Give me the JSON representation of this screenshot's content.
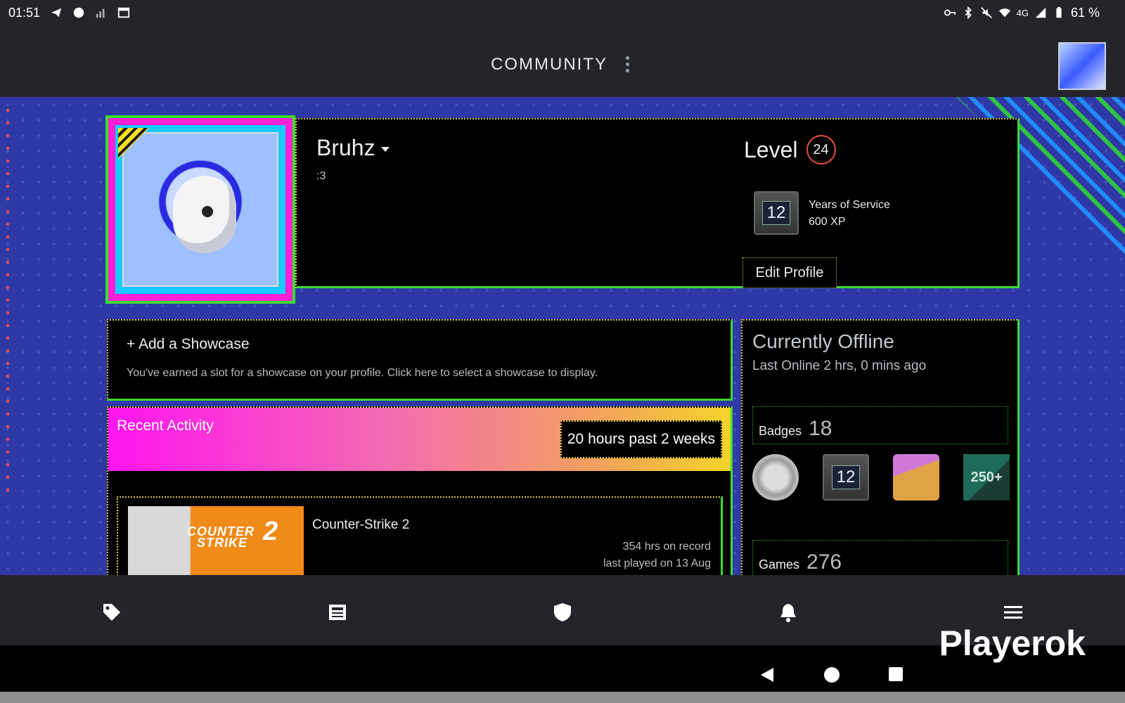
{
  "status_bar": {
    "time": "01:51",
    "battery": "61 %",
    "network": "4G"
  },
  "header": {
    "title": "COMMUNITY"
  },
  "profile": {
    "username": "Bruhz",
    "summary": ":3",
    "level_label": "Level",
    "level": "24",
    "favorite_badge": {
      "icon_text": "12",
      "name": "Years of Service",
      "xp": "600 XP"
    },
    "edit_button": "Edit Profile"
  },
  "showcase": {
    "title": "+ Add a Showcase",
    "description": "You've earned a slot for a showcase on your profile. Click here to select a showcase to display."
  },
  "activity": {
    "title": "Recent Activity",
    "hours": "20 hours past 2 weeks",
    "game": {
      "name": "Counter-Strike 2",
      "capsule_line1": "COUNTER",
      "capsule_line2": "STRIKE",
      "capsule_num": "2",
      "hours_on_record": "354 hrs on record",
      "last_played": "last played on 13 Aug"
    }
  },
  "sidebar": {
    "status": "Currently Offline",
    "last_online": "Last Online 2 hrs, 0 mins ago",
    "badges_label": "Badges",
    "badges_count": "18",
    "badge_icons": [
      "silver-coin-badge",
      "years-of-service-badge",
      "gift-box-badge",
      "250-plus-badge"
    ],
    "badge_12": "12",
    "badge_250": "250+",
    "games_label": "Games",
    "games_count": "276"
  },
  "bottom_nav": [
    "tag-icon",
    "news-icon",
    "shield-icon",
    "bell-icon",
    "menu-icon"
  ],
  "watermark": "Playerok",
  "colors": {
    "background_blue": "#2f39a6",
    "accent_green": "#3ddc2f",
    "accent_magenta": "#ff14f0",
    "level_ring": "#e0503c"
  }
}
